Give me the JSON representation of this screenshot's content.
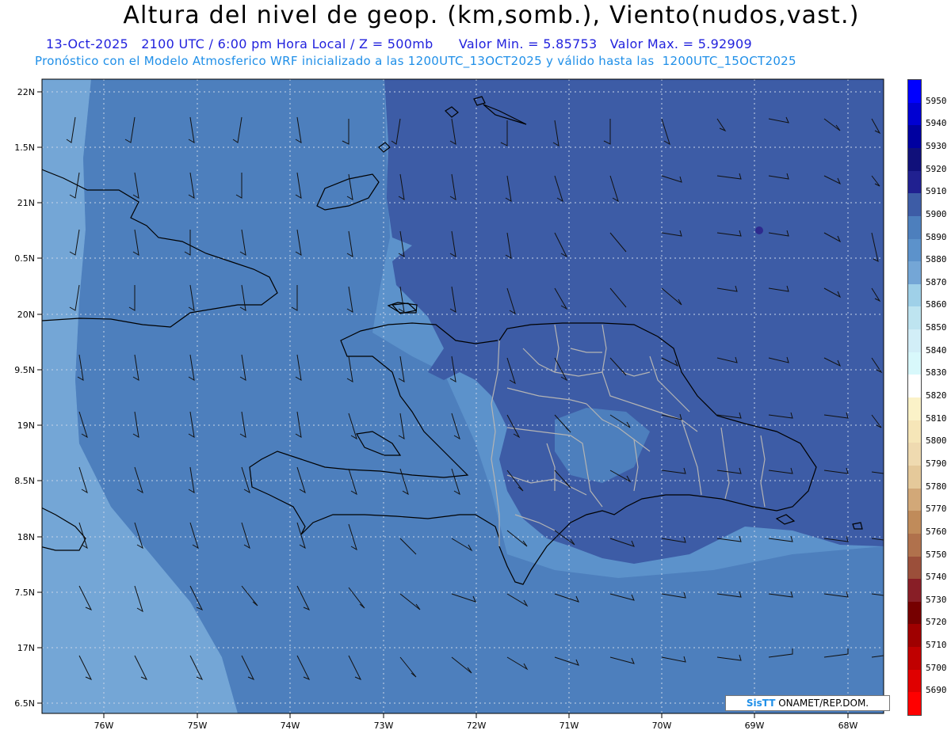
{
  "header": {
    "title": "Altura del nivel de geop. (km,somb.), Viento(nudos,vast.)",
    "subtitle_line1": "13-Oct-2025   2100 UTC / 6:00 pm Hora Local / Z = 500mb      Valor Min. = 5.85753   Valor Max. = 5.92909",
    "subtitle_line2": "Pronóstico con el Modelo Atmosferico WRF inicializado a las 1200UTC_13OCT2025 y válido hasta las  1200UTC_15OCT2025"
  },
  "map": {
    "lat_labels": [
      "22N",
      "1.5N",
      "21N",
      "0.5N",
      "20N",
      "9.5N",
      "19N",
      "8.5N",
      "18N",
      "7.5N",
      "17N",
      "6.5N"
    ],
    "lon_labels": [
      "76W",
      "75W",
      "74W",
      "73W",
      "72W",
      "71W",
      "70W",
      "69W",
      "68W"
    ],
    "colors": {
      "shade_5870": "#74a6d6",
      "shade_5880": "#5c92cb",
      "shade_5890": "#4d7fbd",
      "shade_5900": "#3d5ca6",
      "shade_5910": "#2e2a8e",
      "coastline": "#000000",
      "province_border": "#b4b4b4"
    }
  },
  "legend": {
    "levels": [
      "5950",
      "5940",
      "5930",
      "5920",
      "5910",
      "5900",
      "5890",
      "5880",
      "5870",
      "5860",
      "5850",
      "5840",
      "5830",
      "5820",
      "5810",
      "5800",
      "5790",
      "5780",
      "5770",
      "5760",
      "5750",
      "5740",
      "5730",
      "5720",
      "5710",
      "5700",
      "5690"
    ],
    "colors": [
      "#0000ff",
      "#0000d2",
      "#0000a0",
      "#10107a",
      "#202090",
      "#3d5ca6",
      "#4d7fbd",
      "#5c92cb",
      "#74a6d6",
      "#9fd0e8",
      "#bee4f0",
      "#d2eef7",
      "#d8f8fb",
      "#ffffff",
      "#fbf2c8",
      "#f6e6b8",
      "#efdab0",
      "#e5c99a",
      "#d2a878",
      "#c08b5a",
      "#b0714c",
      "#9b4f3a",
      "#881e26",
      "#760000",
      "#9f0000",
      "#c00000",
      "#e00000",
      "#ff0000"
    ]
  },
  "credit": {
    "brand": "SisTT",
    "text": " ONAMET/REP.DOM."
  }
}
